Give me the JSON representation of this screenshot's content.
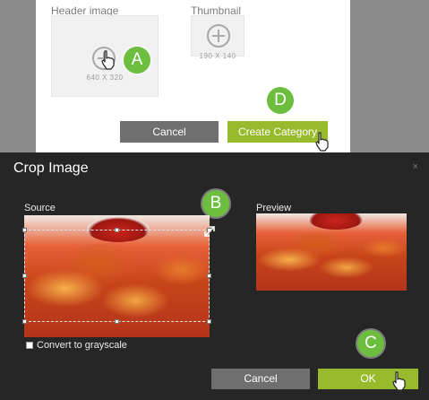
{
  "background_dialog": {
    "header_image_label": "Header image",
    "thumbnail_label": "Thumbnail",
    "header_dims": "640 X 320",
    "thumb_dims": "190 X 140",
    "cancel_label": "Cancel",
    "create_label": "Create Category"
  },
  "crop_modal": {
    "title": "Crop Image",
    "close_glyph": "×",
    "source_label": "Source",
    "preview_label": "Preview",
    "grayscale_label": "Convert to grayscale",
    "grayscale_checked": false,
    "cancel_label": "Cancel",
    "ok_label": "OK"
  },
  "callouts": [
    "A",
    "B",
    "C",
    "D"
  ],
  "colors": {
    "accent_green": "#97bb2c",
    "callout_green": "#6dbd3f",
    "modal_bg": "#262626",
    "overlay": "#8c8c8c",
    "gray_button": "#6f6f6f"
  },
  "icons": [
    "plus-circle-icon",
    "hand-cursor-icon",
    "resize-arrow-icon",
    "close-icon",
    "checkbox-icon"
  ]
}
